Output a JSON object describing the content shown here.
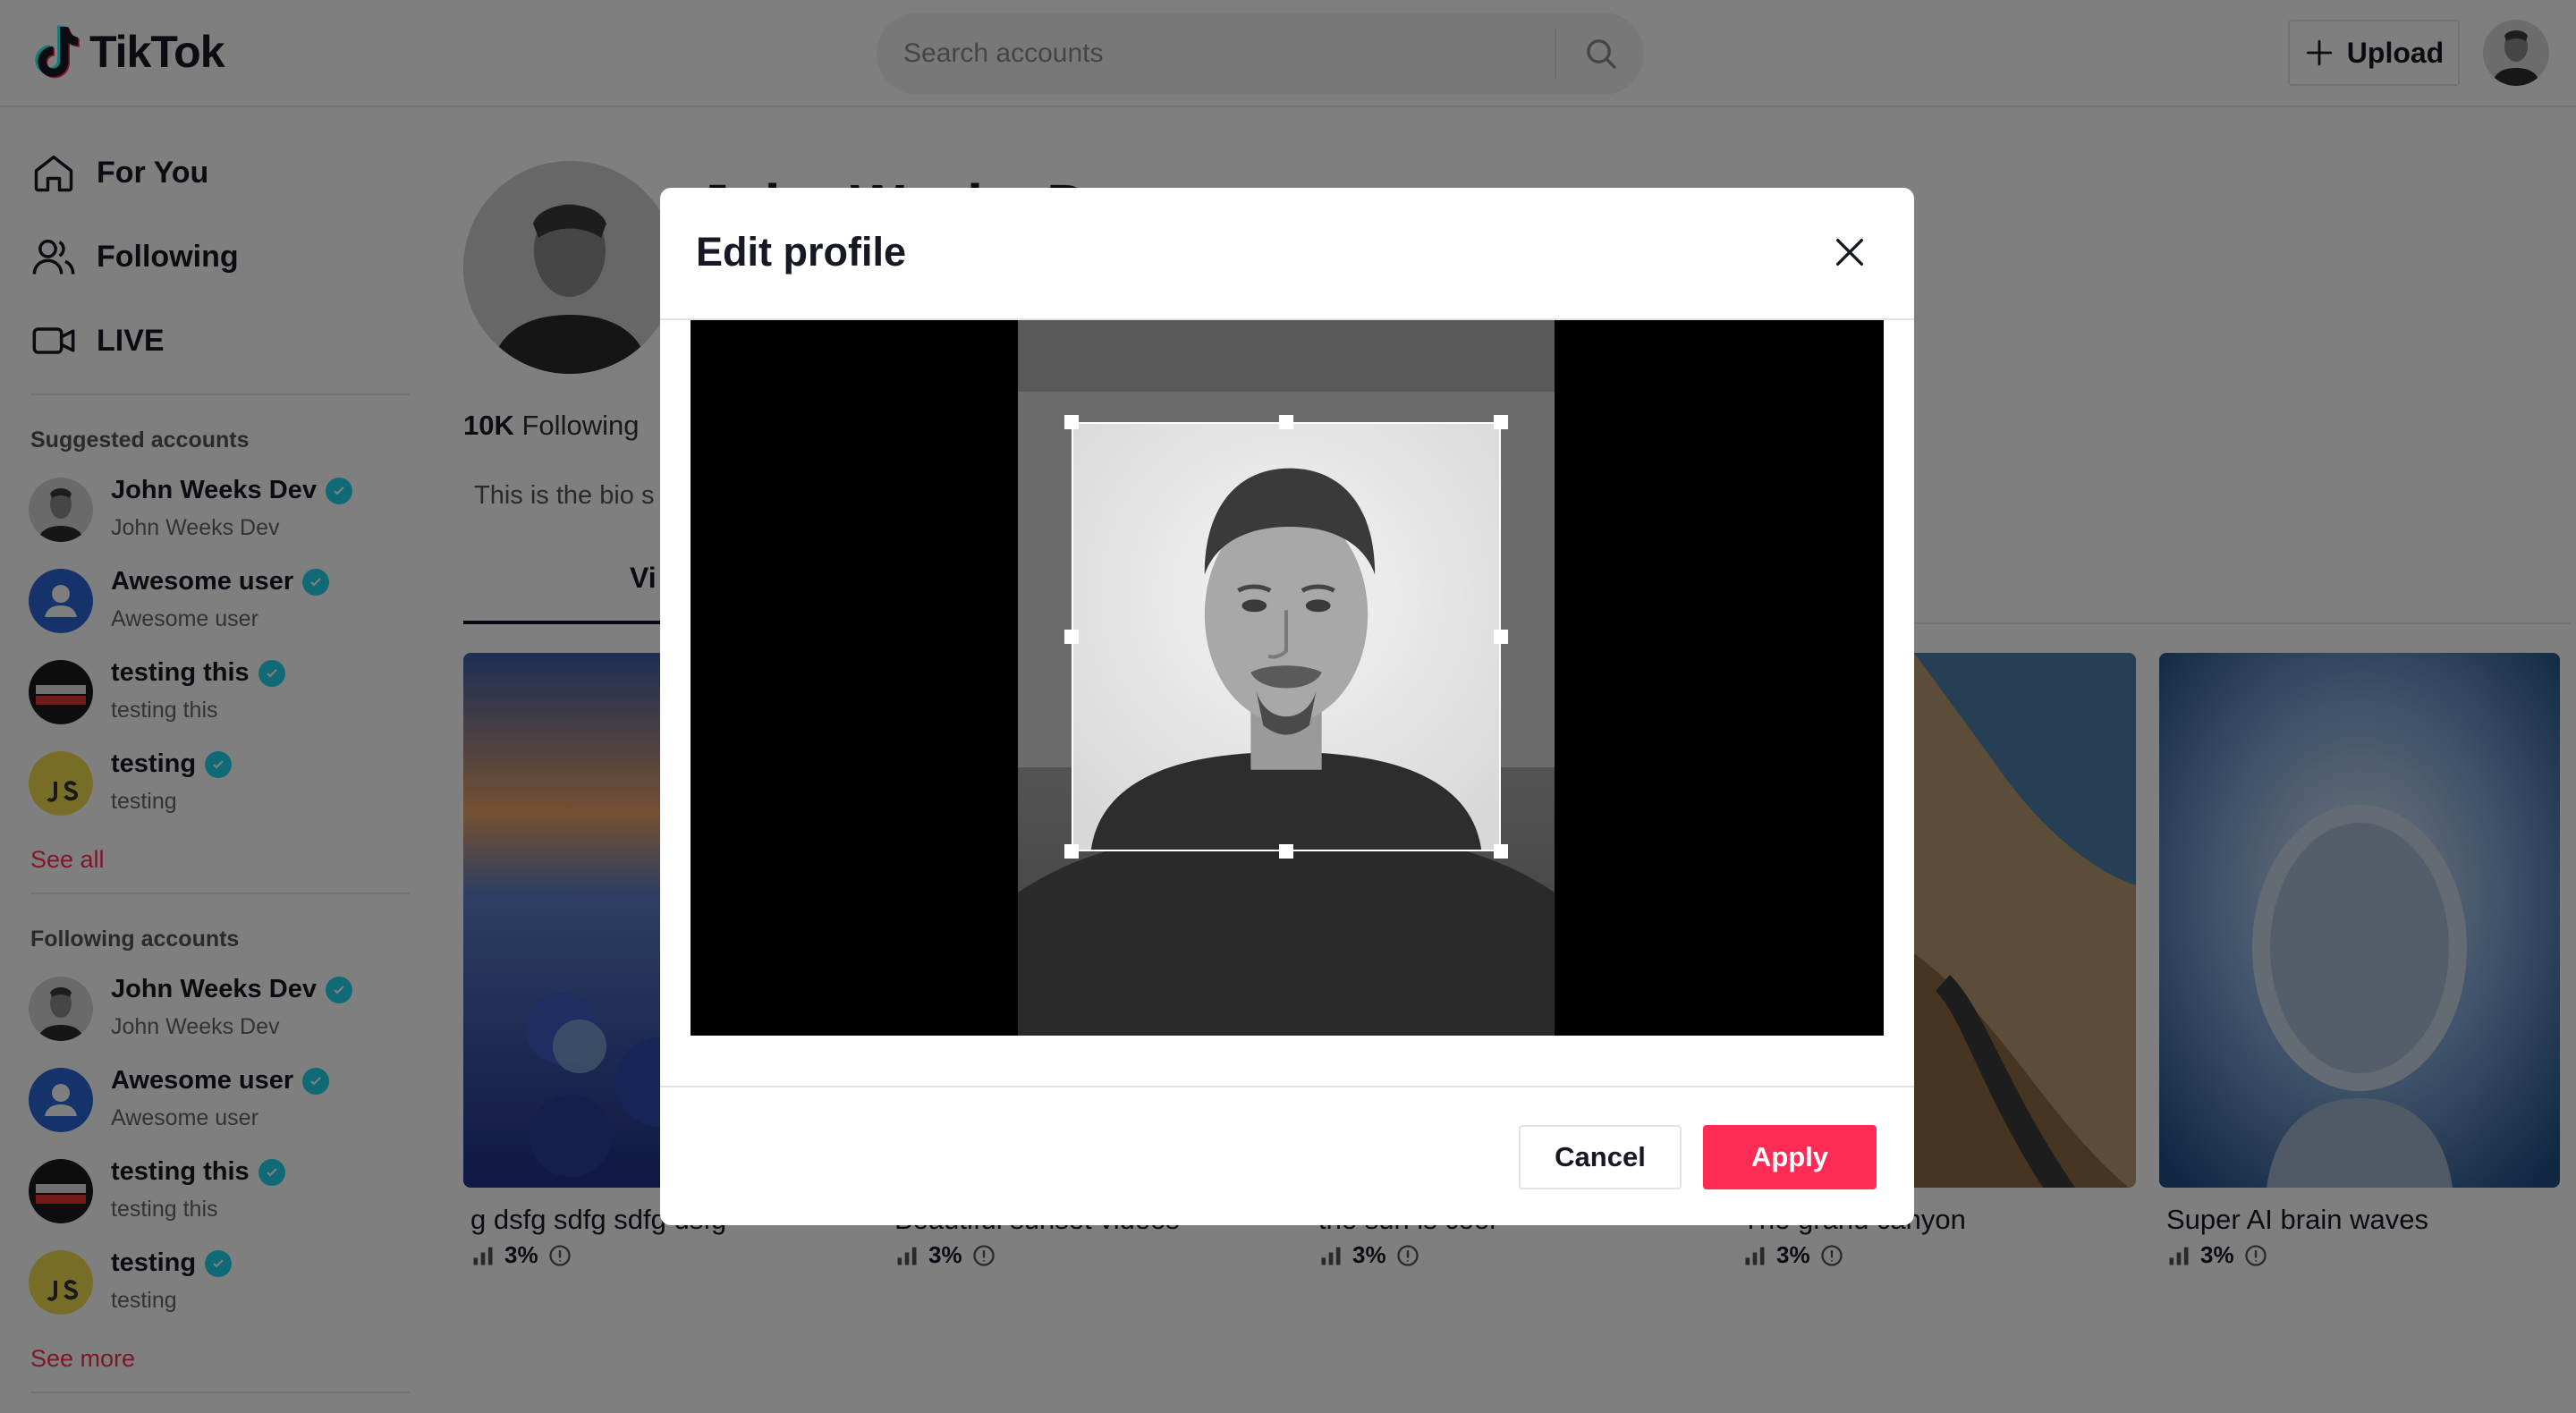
{
  "app": {
    "name": "TikTok"
  },
  "header": {
    "search_placeholder": "Search accounts",
    "upload_label": "Upload"
  },
  "sidebar": {
    "nav": [
      {
        "label": "For You",
        "icon": "home-icon"
      },
      {
        "label": "Following",
        "icon": "users-icon"
      },
      {
        "label": "LIVE",
        "icon": "live-camera-icon"
      }
    ],
    "suggested_heading": "Suggested accounts",
    "suggested": [
      {
        "name": "John Weeks Dev",
        "sub": "John Weeks Dev",
        "avatar": "photo"
      },
      {
        "name": "Awesome user",
        "sub": "Awesome user",
        "avatar": "default"
      },
      {
        "name": "testing this",
        "sub": "testing this",
        "avatar": "fullstack"
      },
      {
        "name": "testing",
        "sub": "testing",
        "avatar": "js"
      }
    ],
    "see_all": "See all",
    "following_heading": "Following accounts",
    "following": [
      {
        "name": "John Weeks Dev",
        "sub": "John Weeks Dev",
        "avatar": "photo"
      },
      {
        "name": "Awesome user",
        "sub": "Awesome user",
        "avatar": "default"
      },
      {
        "name": "testing this",
        "sub": "testing this",
        "avatar": "fullstack"
      },
      {
        "name": "testing",
        "sub": "testing",
        "avatar": "js"
      }
    ],
    "see_more": "See more"
  },
  "profile": {
    "name_partial": "John Weeks D",
    "following_count": "10K",
    "following_label": "Following",
    "bio_partial": "This is the bio s",
    "tab_partial": "Vi"
  },
  "videos": [
    {
      "caption": "g dsfg sdfg sdfg dsfg",
      "stat": "3%"
    },
    {
      "caption": "Beautiful sunset videos",
      "stat": "3%"
    },
    {
      "caption": "the sun is cool",
      "stat": "3%"
    },
    {
      "caption": "The grand canyon",
      "stat": "3%"
    },
    {
      "caption": "Super AI brain waves",
      "stat": "3%"
    }
  ],
  "modal": {
    "title": "Edit profile",
    "cancel_label": "Cancel",
    "apply_label": "Apply"
  },
  "colors": {
    "accent": "#fe2c55",
    "verified": "#20d5ec",
    "overlay": "rgba(0,0,0,0.5)"
  }
}
